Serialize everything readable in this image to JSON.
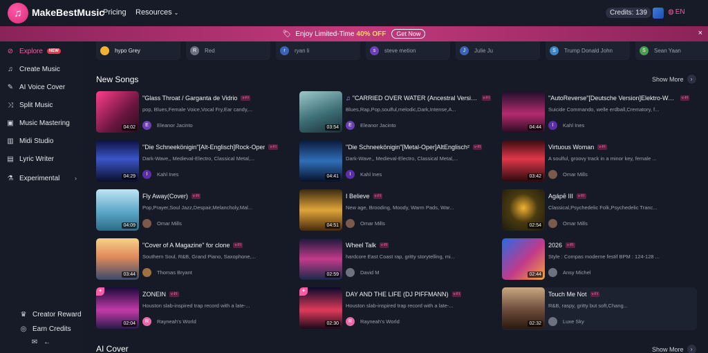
{
  "brand": {
    "name": "MakeBestMusic"
  },
  "topnav": {
    "pricing": "Pricing",
    "resources": "Resources",
    "credits": "Credits: 139",
    "language": "EN"
  },
  "banner": {
    "prefix": "Enjoy Limited-Time",
    "highlight": "40% OFF",
    "cta": "Get Now",
    "close": "×"
  },
  "sidebar": {
    "items": [
      {
        "label": "Explore",
        "badge": "NEW",
        "icon": "compass-icon"
      },
      {
        "label": "Create Music",
        "icon": "music-note-icon"
      },
      {
        "label": "AI Voice Cover",
        "icon": "microphone-icon"
      },
      {
        "label": "Split Music",
        "icon": "split-icon"
      },
      {
        "label": "Music Mastering",
        "icon": "mastering-icon"
      },
      {
        "label": "Midi Studio",
        "icon": "midi-icon"
      },
      {
        "label": "Lyric Writer",
        "icon": "document-icon"
      },
      {
        "label": "Experimental",
        "icon": "flask-icon"
      }
    ],
    "bottom": {
      "creator_reward": "Creator Reward",
      "earn_credits": "Earn Credits"
    }
  },
  "artists": [
    {
      "name": "hypo Grey",
      "initial": "",
      "color": "#f2b233"
    },
    {
      "name": "Red",
      "initial": "R",
      "color": "#6d7280"
    },
    {
      "name": "ryan li",
      "initial": "r",
      "color": "#3a63b8"
    },
    {
      "name": "steve metion",
      "initial": "s",
      "color": "#6b3fb8"
    },
    {
      "name": "Julie Ju",
      "initial": "J",
      "color": "#3a63b8"
    },
    {
      "name": "Trump Donald John",
      "initial": "S",
      "color": "#3a86c8"
    },
    {
      "name": "Sean Yaan",
      "initial": "S",
      "color": "#4a9c4f"
    }
  ],
  "new_songs": {
    "title": "New Songs",
    "show_more": "Show More",
    "items": [
      {
        "title": "\"Glass Throat / Garganta de Vidrio",
        "tag": "v-FI",
        "tags": "pop, Blues,Female Voice,Vocal Fry,Ear candy,...",
        "artist": "Eleanor Jacinto",
        "initial": "E",
        "ava_color": "#6b3fb8",
        "duration": "04:02",
        "thumb": "linear-gradient(135deg,#ff3d8b,#6a1640 60%,#2a0b1c)"
      },
      {
        "title": "\"CARRIED OVER WATER (Ancestral Versio...",
        "tag": "v-FI",
        "tags": "Blues,Rap,Pop,soulful,melodic,Dark,Intense,A...",
        "artist": "Eleanor Jacinto",
        "initial": "E",
        "ava_color": "#6b3fb8",
        "duration": "03:54",
        "thumb": "linear-gradient(160deg,#9ec8c9,#3d6f77 55%,#1b2e36)"
      },
      {
        "title": "\"AutoReverse\"[Deutsche Version]Elektro-Wave",
        "tag": "v-FI",
        "tags": "Suicide Commando, welle erdball,Crematory, f...",
        "artist": "Kahl Ines",
        "initial": "I",
        "ava_color": "#5a2fa8",
        "duration": "04:44",
        "thumb": "linear-gradient(180deg,#1d0f2a,#b52a6e 55%,#2a0c22)"
      },
      {
        "title": "\"Die Schneekönigin\"[Alt-Englisch]Rock-Oper",
        "tag": "v-FI",
        "tags": "Dark-Wave,, Medieval-Electro, Classical Metal,...",
        "artist": "Kahl Ines",
        "initial": "I",
        "ava_color": "#5a2fa8",
        "duration": "04:29",
        "thumb": "linear-gradient(180deg,#0d1240,#3a55c8 45%,#0b0f2b)"
      },
      {
        "title": "\"Die Schneekönigin\"[Metal-Oper]AltEnglisch²",
        "tag": "v-FI",
        "tags": "Dark-Wave,, Medieval-Electro, Classical Metal,...",
        "artist": "Kahl Ines",
        "initial": "I",
        "ava_color": "#5a2fa8",
        "duration": "04:41",
        "thumb": "linear-gradient(180deg,#0a1a3a,#2f6fb8 50%,#08112a)"
      },
      {
        "title": "Virtuous Woman",
        "tag": "v-FI",
        "tags": "A soulful, groovy track in a minor key, female ...",
        "artist": "Omar Mills",
        "initial": "",
        "ava_color": "#7a5a4a",
        "duration": "03:42",
        "thumb": "linear-gradient(180deg,#3a0b10,#e0374a 45%,#2a0a0d)"
      },
      {
        "title": "Fly Away(Cover)",
        "tag": "v-FI",
        "tags": "Pop,Prayer,Soul Jazz,Despair,Melancholy,Mal...",
        "artist": "Omar Mills",
        "initial": "",
        "ava_color": "#7a5a4a",
        "duration": "04:09",
        "thumb": "linear-gradient(180deg,#bfe4f2,#5aa6c8 55%,#2d6a86)"
      },
      {
        "title": "I Believe",
        "tag": "v-FI",
        "tags": "New age, Brooding, Moody, Warm Pads, War...",
        "artist": "Omar Mills",
        "initial": "",
        "ava_color": "#7a5a4a",
        "duration": "04:51",
        "thumb": "linear-gradient(180deg,#3a2a10,#e0a53a 50%,#4a2a0d)"
      },
      {
        "title": "Agápē III",
        "tag": "v-FI",
        "tags": "Classical,Psychedelic Folk,Psychedelic Tranc...",
        "artist": "Omar Mills",
        "initial": "",
        "ava_color": "#7a5a4a",
        "duration": "02:54",
        "thumb": "radial-gradient(circle at 50% 45%,#f2b233,#4a3a10 45%,#1a1a10)"
      },
      {
        "title": "\"Cover of A Magazine\" for clone",
        "tag": "v-FI",
        "tags": "Southern Soul, R&B, Grand Piano, Saxophone,...",
        "artist": "Thomas Bryant",
        "initial": "",
        "ava_color": "#a07040",
        "duration": "03:44",
        "thumb": "linear-gradient(180deg,#f5d28a,#e08a5a 45%,#3a4a6a)"
      },
      {
        "title": "Wheel Talk",
        "tag": "v-FI",
        "tags": "hardcore East Coast rap, gritty storytelling, mi...",
        "artist": "David M",
        "initial": "",
        "ava_color": "#6d7280",
        "duration": "02:59",
        "thumb": "linear-gradient(180deg,#1a1a3a,#c23a8a 50%,#1a2a4a)"
      },
      {
        "title": "2026",
        "tag": "v-FI",
        "tags": "Style : Compas moderne festif BPM : 124-128 ...",
        "artist": "Ansy Michel",
        "initial": "",
        "ava_color": "#6d7280",
        "duration": "02:44",
        "thumb": "linear-gradient(135deg,#2a6ae0,#c23a8a 55%,#f5a53a)"
      },
      {
        "title": "ZONEIN",
        "tag": "v-FI",
        "tags": "Houston slab-inspired trap record with a late-...",
        "artist": "Rayneah's World",
        "initial": "R",
        "ava_color": "#e86aa8",
        "duration": "02:04",
        "thumb": "linear-gradient(180deg,#1a0a3a,#c23aa8 55%,#2a1a4a)",
        "pinned": true
      },
      {
        "title": "DAY AND THE LIFE (DJ PIFFMANN)",
        "tag": "v-FI",
        "tags": "Houston slab-inspired trap record with a late-...",
        "artist": "Rayneah's World",
        "initial": "R",
        "ava_color": "#e86aa8",
        "duration": "02:30",
        "thumb": "linear-gradient(180deg,#0a0a2a,#e03a5a 55%,#1a0a1a)",
        "pinned": true
      },
      {
        "title": "Touch Me Not",
        "tag": "v-FI",
        "tags": "R&B, raspy, gritty but soft,Chang...",
        "artist": "Luxe Sky",
        "initial": "",
        "ava_color": "#6d7280",
        "duration": "02:32",
        "thumb": "linear-gradient(180deg,#c8a880,#6a4a3a 55%,#2a1a10)",
        "highlighted": true
      }
    ]
  },
  "ai_cover": {
    "title": "AI Cover",
    "show_more": "Show More"
  }
}
